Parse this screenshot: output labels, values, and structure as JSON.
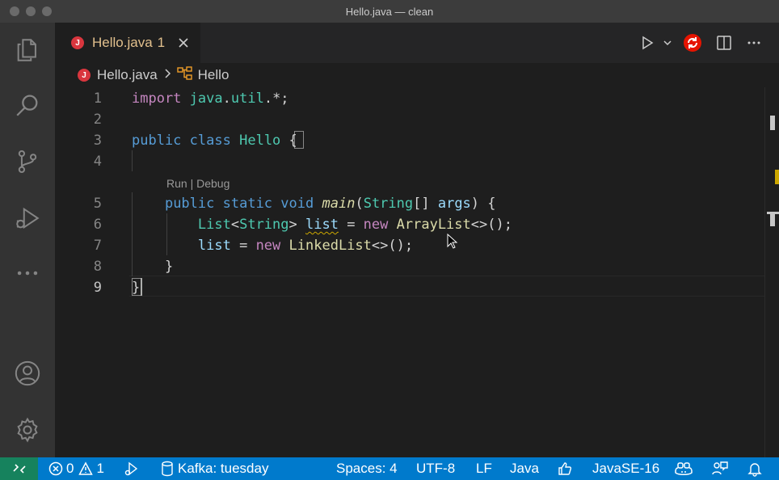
{
  "window": {
    "title": "Hello.java — clean"
  },
  "activity_bar": {
    "items": [
      "explorer-icon",
      "search-icon",
      "source-control-icon",
      "run-debug-icon",
      "more-icon"
    ],
    "bottom_items": [
      "account-icon",
      "settings-gear-icon"
    ]
  },
  "tab": {
    "badge": "J",
    "label": "Hello.java",
    "problem_count": "1"
  },
  "breadcrumb": {
    "file": "Hello.java",
    "symbol": "Hello"
  },
  "editor": {
    "line_numbers": [
      "1",
      "2",
      "3",
      "4",
      "5",
      "6",
      "7",
      "8",
      "9"
    ],
    "lines": {
      "l1": {
        "kw": "import",
        "pkg": "java",
        "dot1": ".",
        "util": "util",
        "rest": ".*;"
      },
      "l3": {
        "pub": "public",
        "cls_kw": "class",
        "name": "Hello",
        "brace": "{"
      },
      "l5": {
        "pub": "public",
        "static": "static",
        "void": "void",
        "fn": "main",
        "lp": "(",
        "type": "String",
        "arr": "[] ",
        "arg": "args",
        "tail": ") {"
      },
      "l6": {
        "type": "List",
        "lt": "<",
        "gen": "String",
        "gt": "> ",
        "var": "list",
        "eq": " = ",
        "new": "new",
        "ctor": "ArrayList",
        "tail": "<>();"
      },
      "l7": {
        "var": "list",
        "eq": " = ",
        "new": "new",
        "ctor": "LinkedList",
        "tail": "<>();"
      },
      "l8": {
        "brace": "}"
      },
      "l9": {
        "brace": "}"
      }
    },
    "codelens": "Run | Debug"
  },
  "status_bar": {
    "errors": "0",
    "warnings": "1",
    "kafka": "Kafka: tuesday",
    "spaces": "Spaces: 4",
    "encoding": "UTF-8",
    "eol": "LF",
    "language": "Java",
    "jdk": "JavaSE-16"
  },
  "colors": {
    "accent": "#007acc",
    "remote": "#16825d",
    "java_badge": "#d9363e",
    "modified_tab": "#e2c08d"
  }
}
